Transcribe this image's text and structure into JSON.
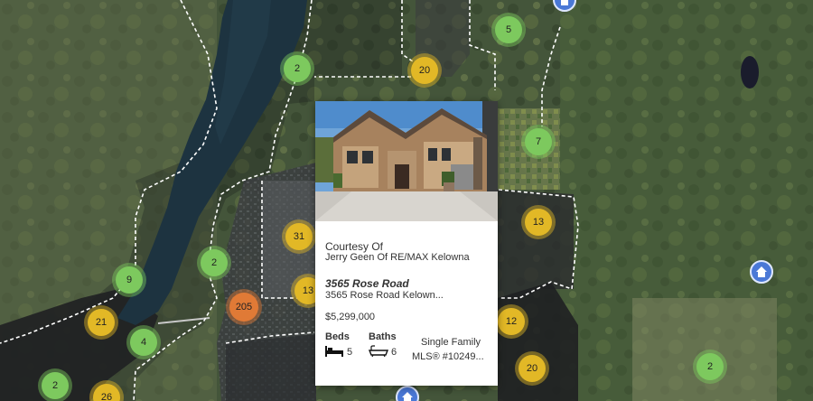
{
  "colors": {
    "cluster_green": "#7dc95e",
    "cluster_yellow": "#e2b826",
    "cluster_orange": "#e07a36",
    "home_pin": "#4a78d6",
    "boundary": "#ffffff",
    "lake": "#1d3340"
  },
  "clusters": [
    {
      "count": "5",
      "color": "green"
    },
    {
      "count": "2",
      "color": "green"
    },
    {
      "count": "20",
      "color": "yellow"
    },
    {
      "count": "7",
      "color": "green"
    },
    {
      "count": "13",
      "color": "yellow"
    },
    {
      "count": "31",
      "color": "yellow"
    },
    {
      "count": "2",
      "color": "green"
    },
    {
      "count": "13",
      "color": "yellow"
    },
    {
      "count": "205",
      "color": "orange"
    },
    {
      "count": "9",
      "color": "green"
    },
    {
      "count": "21",
      "color": "yellow"
    },
    {
      "count": "4",
      "color": "green"
    },
    {
      "count": "12",
      "color": "yellow"
    },
    {
      "count": "20",
      "color": "yellow"
    },
    {
      "count": "2",
      "color": "green"
    },
    {
      "count": "2",
      "color": "green"
    },
    {
      "count": "26",
      "color": "yellow"
    }
  ],
  "home_pins": [
    {
      "icon": "home-icon"
    },
    {
      "icon": "home-icon"
    },
    {
      "icon": "home-icon"
    }
  ],
  "popup": {
    "courtesy_label": "Courtesy Of",
    "courtesy_name": "Jerry Geen Of RE/MAX Kelowna",
    "address_title": "3565 Rose Road",
    "address_sub": "3565 Rose Road Kelown...",
    "price": "$5,299,000",
    "beds_label": "Beds",
    "beds_value": "5",
    "baths_label": "Baths",
    "baths_value": "6",
    "property_type": "Single Family",
    "mls": "MLS® #10249..."
  }
}
